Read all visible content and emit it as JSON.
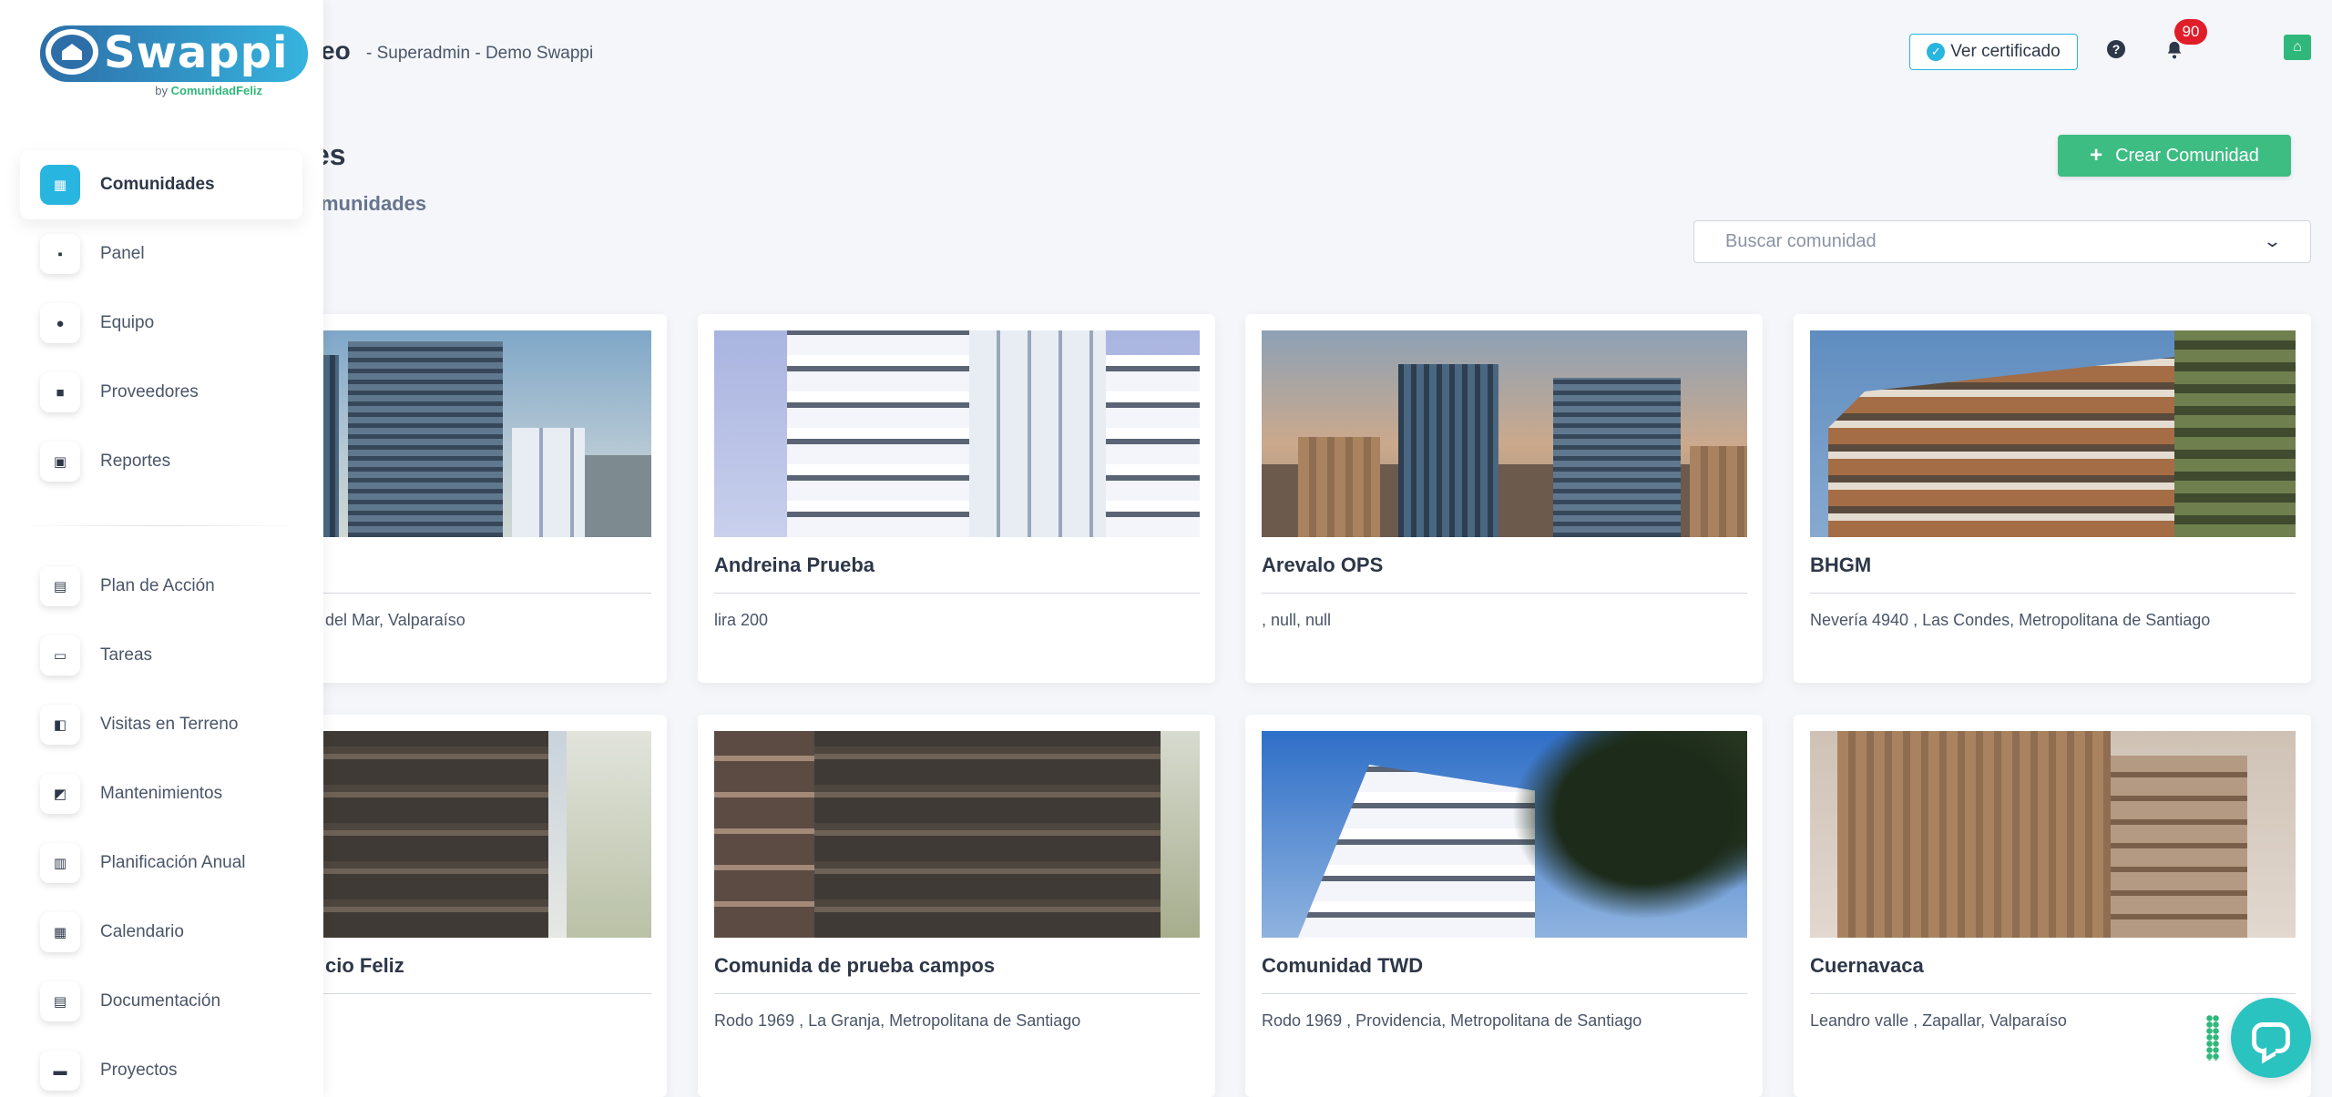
{
  "header": {
    "title_fragment": "eo",
    "subtitle": "- Superadmin - Demo Swappi",
    "certificate_label": "Ver certificado",
    "notification_count": "90"
  },
  "logo": {
    "brand": "Swappi",
    "by_prefix": "by",
    "by_brand": "ComunidadFeliz"
  },
  "sidebar": {
    "items_top": [
      {
        "label": "Comunidades",
        "icon": "building-icon",
        "active": true
      },
      {
        "label": "Panel",
        "icon": "dashboard-icon"
      },
      {
        "label": "Equipo",
        "icon": "team-icon"
      },
      {
        "label": "Proveedores",
        "icon": "truck-icon"
      },
      {
        "label": "Reportes",
        "icon": "save-icon"
      }
    ],
    "items_bottom": [
      {
        "label": "Plan de Acción",
        "icon": "book-icon"
      },
      {
        "label": "Tareas",
        "icon": "inbox-icon"
      },
      {
        "label": "Visitas en Terreno",
        "icon": "walk-icon"
      },
      {
        "label": "Mantenimientos",
        "icon": "tools-icon"
      },
      {
        "label": "Planificación Anual",
        "icon": "planner-icon"
      },
      {
        "label": "Calendario",
        "icon": "calendar-icon"
      },
      {
        "label": "Documentación",
        "icon": "document-icon"
      },
      {
        "label": "Proyectos",
        "icon": "folder-icon"
      }
    ]
  },
  "main": {
    "section_title_fragment": "es",
    "section_subtitle_fragment": "munidades",
    "create_button": "Crear Comunidad",
    "search_placeholder": "Buscar comunidad"
  },
  "cards": [
    {
      "name": "",
      "address": "del Mar, Valparaíso"
    },
    {
      "name": "Andreina Prueba",
      "address": "lira 200"
    },
    {
      "name": "Arevalo OPS",
      "address": ", null, null"
    },
    {
      "name": "BHGM",
      "address": "Nevería 4940 , Las Condes, Metropolitana de Santiago"
    },
    {
      "name": "cio Feliz",
      "address": ""
    },
    {
      "name": "Comunida de prueba campos",
      "address": "Rodo 1969 , La Granja, Metropolitana de Santiago"
    },
    {
      "name": "Comunidad TWD",
      "address": "Rodo 1969 , Providencia, Metropolitana de Santiago"
    },
    {
      "name": "Cuernavaca",
      "address": "Leandro valle , Zapallar, Valparaíso"
    }
  ],
  "colors": {
    "accent": "#28b5df",
    "primary_button": "#3dbd82",
    "badge": "#e11d2a",
    "chat": "#2ac3c0"
  }
}
